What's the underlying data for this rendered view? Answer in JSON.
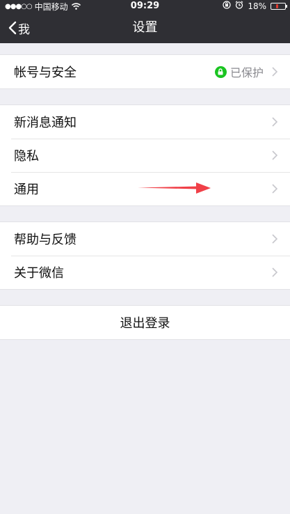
{
  "status_bar": {
    "signal": "●●●○○",
    "carrier": "中国移动",
    "time": "09:29",
    "battery": "18%",
    "battery_level": 0.18,
    "battery_color": "#e23b30"
  },
  "nav": {
    "back_label": "我",
    "title": "设置"
  },
  "groups": [
    {
      "rows": [
        {
          "label": "帐号与安全",
          "status": "已保护",
          "status_icon": "lock-icon",
          "status_color": "#1ac421"
        }
      ]
    },
    {
      "rows": [
        {
          "label": "新消息通知"
        },
        {
          "label": "隐私"
        },
        {
          "label": "通用"
        }
      ]
    },
    {
      "rows": [
        {
          "label": "帮助与反馈"
        },
        {
          "label": "关于微信"
        }
      ]
    }
  ],
  "logout_label": "退出登录",
  "annotation": {
    "arrow_color": "#f04048"
  }
}
